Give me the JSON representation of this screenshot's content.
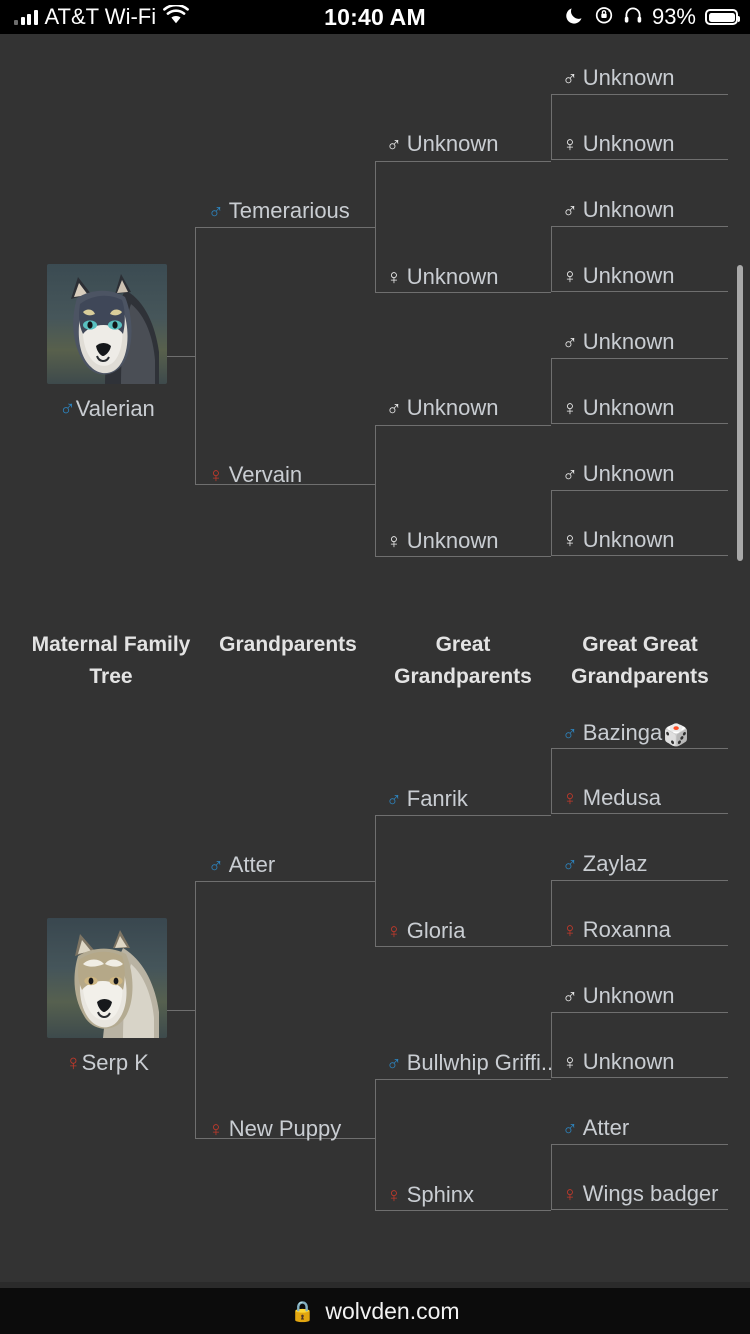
{
  "status_bar": {
    "carrier": "AT&T Wi-Fi",
    "signal_icon": "cellular-bars-icon",
    "wifi_icon": "wifi-icon",
    "time": "10:40 AM",
    "dnd_icon": "moon-icon",
    "rotation_lock_icon": "rotation-lock-icon",
    "headphones_icon": "headphones-icon",
    "battery_percent": "93%",
    "battery_icon": "battery-icon"
  },
  "browser": {
    "lock_icon": "lock-icon",
    "host": "wolvden.com"
  },
  "headers": [
    {
      "line1": "Maternal Family",
      "line2": "Tree"
    },
    {
      "line1": "Grandparents",
      "line2": ""
    },
    {
      "line1": "Great",
      "line2": "Grandparents"
    },
    {
      "line1": "Great Great",
      "line2": "Grandparents"
    }
  ],
  "paternal_tree": {
    "subject": {
      "name": "Valerian",
      "sex": "m",
      "portrait": "wolf-portrait-dark"
    },
    "parents": [
      {
        "name": "Temerarious",
        "sex": "m"
      },
      {
        "name": "Vervain",
        "sex": "f"
      }
    ],
    "grandparents": [
      {
        "name": "Unknown",
        "sex": "m",
        "unknown": true
      },
      {
        "name": "Unknown",
        "sex": "f",
        "unknown": true
      },
      {
        "name": "Unknown",
        "sex": "m",
        "unknown": true
      },
      {
        "name": "Unknown",
        "sex": "f",
        "unknown": true
      }
    ],
    "great_grandparents": [
      {
        "name": "Unknown",
        "sex": "m",
        "unknown": true
      },
      {
        "name": "Unknown",
        "sex": "f",
        "unknown": true
      },
      {
        "name": "Unknown",
        "sex": "m",
        "unknown": true
      },
      {
        "name": "Unknown",
        "sex": "f",
        "unknown": true
      },
      {
        "name": "Unknown",
        "sex": "m",
        "unknown": true
      },
      {
        "name": "Unknown",
        "sex": "f",
        "unknown": true
      },
      {
        "name": "Unknown",
        "sex": "m",
        "unknown": true
      },
      {
        "name": "Unknown",
        "sex": "f",
        "unknown": true
      }
    ]
  },
  "maternal_tree": {
    "subject": {
      "name": "Serp K",
      "sex": "f",
      "portrait": "wolf-portrait-light"
    },
    "parents": [
      {
        "name": "Atter",
        "sex": "m"
      },
      {
        "name": "New Puppy",
        "sex": "f"
      }
    ],
    "grandparents": [
      {
        "name": "Fanrik",
        "sex": "m"
      },
      {
        "name": "Gloria",
        "sex": "f"
      },
      {
        "name": "Bullwhip Griffi..",
        "sex": "m"
      },
      {
        "name": "Sphinx",
        "sex": "f"
      }
    ],
    "great_grandparents": [
      {
        "name": "Bazinga",
        "sex": "m",
        "suffix_icon": "game-die-icon"
      },
      {
        "name": "Medusa",
        "sex": "f"
      },
      {
        "name": "Zaylaz",
        "sex": "m"
      },
      {
        "name": "Roxanna",
        "sex": "f"
      },
      {
        "name": "Unknown",
        "sex": "m",
        "unknown": true
      },
      {
        "name": "Unknown",
        "sex": "f",
        "unknown": true
      },
      {
        "name": "Atter",
        "sex": "m"
      },
      {
        "name": "Wings badger",
        "sex": "f"
      }
    ]
  },
  "colors": {
    "background": "#333333",
    "male": "#2d83bd",
    "female": "#c0392b",
    "text": "#c9cdd2",
    "line": "#6f6f6f",
    "unknown_text": "#d8d8d8"
  }
}
